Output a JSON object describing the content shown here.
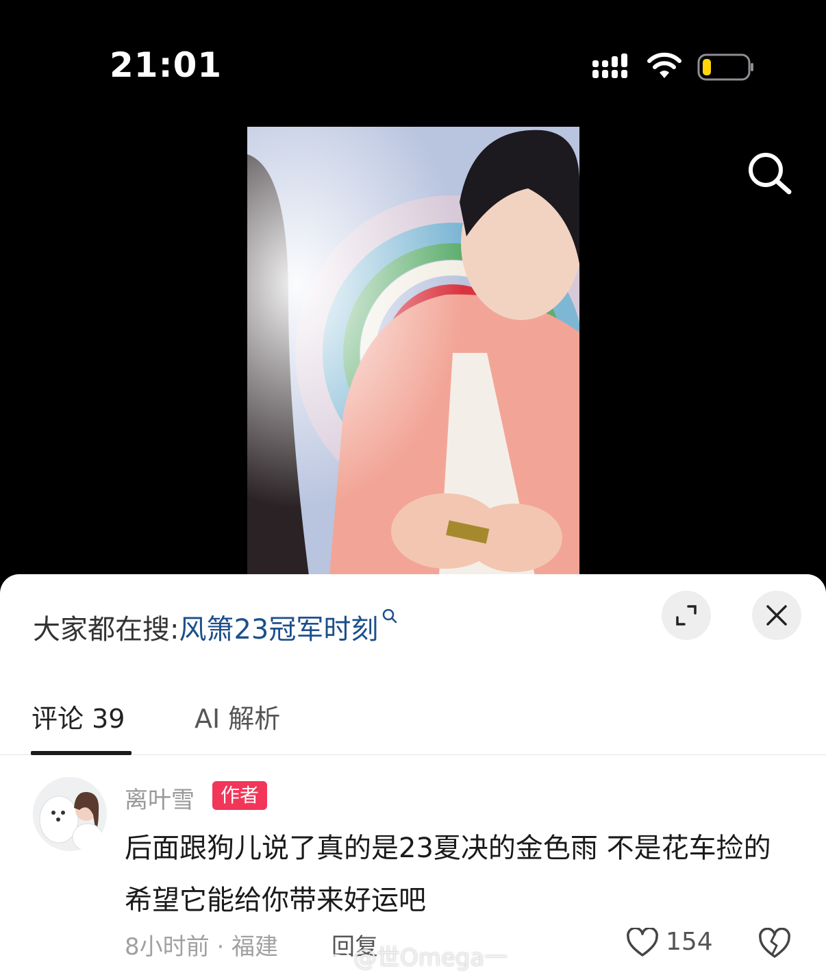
{
  "status_bar": {
    "time": "21:01",
    "icons": [
      "cellular-signal-icon",
      "wifi-icon",
      "battery-low-icon"
    ],
    "battery_color": "#ffd60a"
  },
  "video": {
    "icons": [
      "search-icon"
    ]
  },
  "sheet": {
    "trending": {
      "label": "大家都在搜:",
      "query": "风箫23冠军时刻",
      "query_color": "#1d4f8a"
    },
    "buttons": {
      "icons": [
        "expand-icon",
        "close-icon"
      ]
    },
    "tabs": [
      {
        "label": "评论 39",
        "active": true
      },
      {
        "label": "AI 解析",
        "active": false
      }
    ],
    "comment": {
      "username": "离叶雪",
      "badge": "作者",
      "badge_color": "#f23659",
      "text": "后面跟狗儿说了真的是23夏决的金色雨 不是花车捡的 希望它能给你带来好运吧",
      "meta": "8小时前 · 福建",
      "reply_label": "回复",
      "like_count": "154",
      "icons": [
        "heart-icon",
        "dislike-heart-icon"
      ]
    }
  },
  "watermark": {
    "text": "@世Omega一"
  }
}
